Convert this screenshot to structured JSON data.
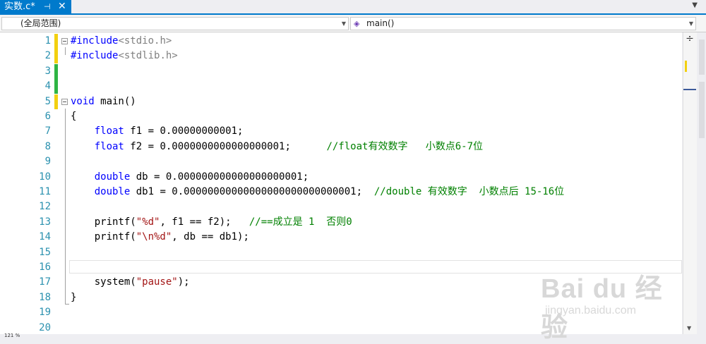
{
  "tab": {
    "title": "实数.c*",
    "pin": "⊣",
    "close": "✕"
  },
  "nav": {
    "scope": "(全局范围)",
    "member": "main()"
  },
  "editor": {
    "lines": [
      {
        "n": "1",
        "tokens": [
          {
            "t": "#include",
            "c": "kw"
          },
          {
            "t": "<stdio.h>",
            "c": "inc"
          }
        ]
      },
      {
        "n": "2",
        "tokens": [
          {
            "t": "#include",
            "c": "kw"
          },
          {
            "t": "<stdlib.h>",
            "c": "inc"
          }
        ]
      },
      {
        "n": "3",
        "tokens": []
      },
      {
        "n": "4",
        "tokens": []
      },
      {
        "n": "5",
        "tokens": [
          {
            "t": "void",
            "c": "kw"
          },
          {
            "t": " main()",
            "c": ""
          }
        ]
      },
      {
        "n": "6",
        "tokens": [
          {
            "t": "{",
            "c": ""
          }
        ]
      },
      {
        "n": "7",
        "tokens": [
          {
            "t": "    ",
            "c": ""
          },
          {
            "t": "float",
            "c": "kw"
          },
          {
            "t": " f1 = 0.00000000001;",
            "c": ""
          }
        ]
      },
      {
        "n": "8",
        "tokens": [
          {
            "t": "    ",
            "c": ""
          },
          {
            "t": "float",
            "c": "kw"
          },
          {
            "t": " f2 = 0.0000000000000000001;      ",
            "c": ""
          },
          {
            "t": "//float有效数字   小数点6-7位",
            "c": "cm"
          }
        ]
      },
      {
        "n": "9",
        "tokens": []
      },
      {
        "n": "10",
        "tokens": [
          {
            "t": "    ",
            "c": ""
          },
          {
            "t": "double",
            "c": "kw"
          },
          {
            "t": " db = 0.000000000000000000001;",
            "c": ""
          }
        ]
      },
      {
        "n": "11",
        "tokens": [
          {
            "t": "    ",
            "c": ""
          },
          {
            "t": "double",
            "c": "kw"
          },
          {
            "t": " db1 = 0.00000000000000000000000000001;  ",
            "c": ""
          },
          {
            "t": "//double 有效数字  小数点后 15-16位",
            "c": "cm"
          }
        ]
      },
      {
        "n": "12",
        "tokens": []
      },
      {
        "n": "13",
        "tokens": [
          {
            "t": "    printf(",
            "c": ""
          },
          {
            "t": "\"%d\"",
            "c": "str"
          },
          {
            "t": ", f1 == f2);   ",
            "c": ""
          },
          {
            "t": "//==成立是 1  否则0",
            "c": "cm"
          }
        ]
      },
      {
        "n": "14",
        "tokens": [
          {
            "t": "    printf(",
            "c": ""
          },
          {
            "t": "\"\\n%d\"",
            "c": "str"
          },
          {
            "t": ", db == db1);",
            "c": ""
          }
        ]
      },
      {
        "n": "15",
        "tokens": []
      },
      {
        "n": "16",
        "tokens": []
      },
      {
        "n": "17",
        "tokens": [
          {
            "t": "    system(",
            "c": ""
          },
          {
            "t": "\"pause\"",
            "c": "str"
          },
          {
            "t": ");",
            "c": ""
          }
        ]
      },
      {
        "n": "18",
        "tokens": [
          {
            "t": "}",
            "c": ""
          }
        ]
      },
      {
        "n": "19",
        "tokens": []
      },
      {
        "n": "20",
        "tokens": []
      }
    ],
    "change_marks": {
      "1": "#f2d010",
      "2": "#f2d010",
      "3": "#2fb443",
      "4": "#2fb443",
      "5": "#f2d010"
    },
    "fold_lines": [
      "1",
      "5"
    ]
  },
  "scroll": {
    "split_icon": "÷"
  },
  "watermark": {
    "brand": "Bai du 经验",
    "sub": "jingyan.baidu.com"
  },
  "status": {
    "zoom": "121 %"
  }
}
